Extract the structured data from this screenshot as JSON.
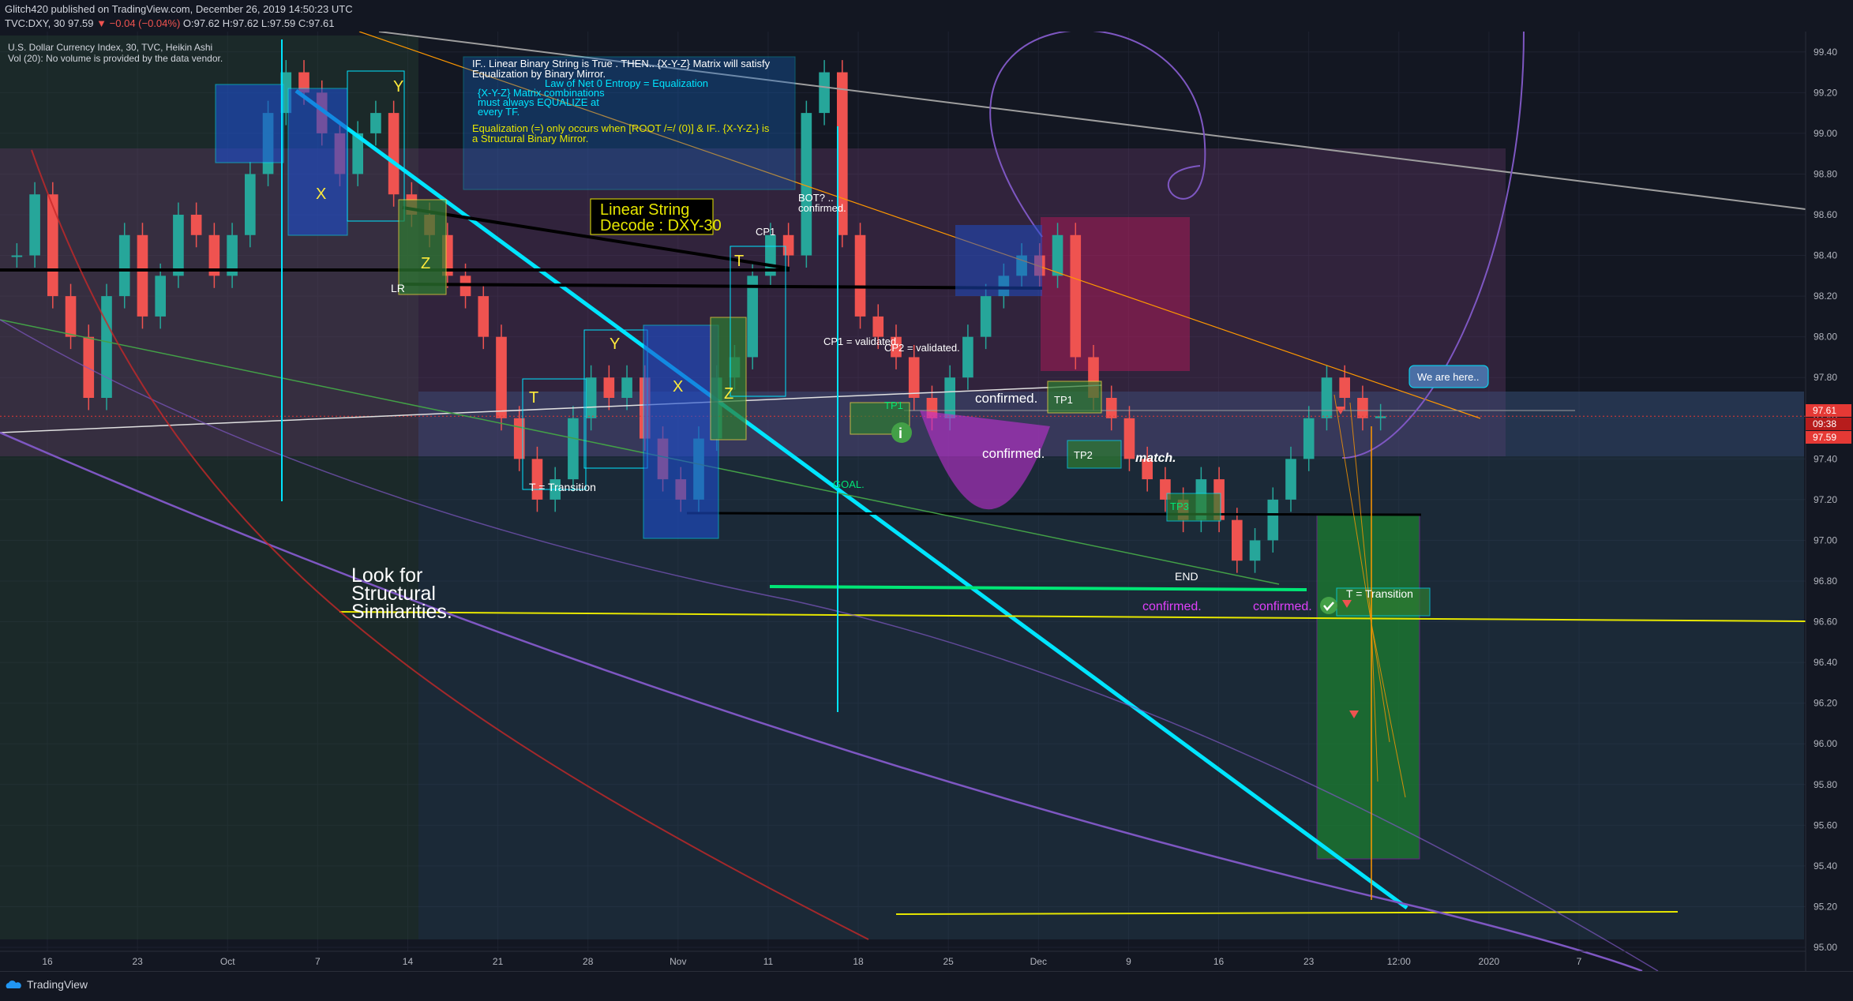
{
  "header": {
    "publisher_line": "Glitch420 published on TradingView.com, December 26, 2019 14:50:23 UTC",
    "symbol": "TVC:DXY, 30",
    "last": "97.59",
    "change": "−0.04 (−0.04%)",
    "ohlc": "O:97.62 H:97.62 L:97.59 C:97.61"
  },
  "legend": {
    "title": "U.S. Dollar Currency Index, 30, TVC, Heikin Ashi",
    "volume_note": "Vol (20): No volume is provided by the data vendor."
  },
  "annotations": {
    "matrix_note": [
      "IF.. Linear Binary String is True . THEN.. {X-Y-Z} Matrix will satisfy",
      "Equalization by Binary Mirror.",
      "Law of Net 0 Entropy = Equalization",
      "{X-Y-Z} Matrix combinations",
      "must always EQUALIZE at",
      "every TF.",
      "Equalization (=) only occurs when [ROOT /=/ (0)]  & IF.. {X-Y-Z-} is",
      "a Structural Binary Mirror."
    ],
    "linear_string": [
      "Linear String",
      "Decode : DXY-30"
    ],
    "look_for": [
      "Look for",
      "Structural",
      "Similarities."
    ],
    "we_are_here": "We are here..",
    "transition_left": "T = Transition",
    "transition_right": "T = Transition",
    "confirmed_1": "confirmed.",
    "confirmed_2": "confirmed.",
    "confirmed_3": "confirmed.",
    "confirmed_4": "confirmed.",
    "match": "match.",
    "end": "END",
    "goal": "GOAL.",
    "tp1_a": "TP1",
    "tp1_b": "TP1",
    "tp2": "TP2",
    "tp3": "TP3",
    "lr": "LR",
    "bot": "BOT? ..",
    "bot_confirmed": "confirmed.",
    "validated_1": "CP1 = validated.",
    "validated_2": "CP2 = validated.",
    "cp1": "CP1",
    "x1": "X",
    "y1": "Y",
    "z1": "Z",
    "x2": "X",
    "y2": "Y",
    "z2": "Z",
    "t1": "T",
    "t2": "T",
    "info_icon": "i"
  },
  "price_labels": {
    "current": "97.61",
    "countdown": "09:38",
    "close": "97.59"
  },
  "footer": {
    "brand": "TradingView"
  },
  "colors": {
    "background": "#131722",
    "up": "#26a69a",
    "down": "#ef5350",
    "cyan_trendline": "#00e5ff",
    "yellow_line": "#e6e600",
    "magenta": "#e040fb",
    "purple_curve": "#7e57c2"
  },
  "chart_data": {
    "type": "candlestick",
    "title": "U.S. Dollar Currency Index, 30, TVC, Heikin Ashi",
    "xlabel": "",
    "ylabel": "",
    "x_ticks": [
      "16",
      "23",
      "Oct",
      "7",
      "14",
      "21",
      "28",
      "Nov",
      "11",
      "18",
      "25",
      "Dec",
      "9",
      "16",
      "23",
      "12:00",
      "2020",
      "7"
    ],
    "ylim": [
      95.0,
      99.5
    ],
    "y_ticks": [
      95.0,
      95.2,
      95.4,
      95.6,
      95.8,
      96.0,
      96.2,
      96.4,
      96.6,
      96.8,
      97.0,
      97.2,
      97.4,
      97.6,
      97.8,
      98.0,
      98.2,
      98.4,
      98.6,
      98.8,
      99.0,
      99.2,
      99.4
    ],
    "series": [
      {
        "values": [
          98.4,
          98.7,
          98.2,
          98.0,
          97.7,
          98.2,
          98.5,
          98.1,
          98.3,
          98.6,
          98.5,
          98.3,
          98.5,
          98.8,
          99.1,
          99.3,
          99.2,
          99.0,
          98.8,
          99.0,
          99.1,
          98.7,
          98.6,
          98.5,
          98.3,
          98.2,
          98.0,
          97.6,
          97.4,
          97.2,
          97.3,
          97.6,
          97.8,
          97.7,
          97.8,
          97.5,
          97.3,
          97.2,
          97.5,
          97.8,
          97.9,
          98.3,
          98.5,
          98.4,
          99.1,
          99.3,
          98.5,
          98.1,
          98.0,
          97.9,
          97.7,
          97.6,
          97.8,
          98.0,
          98.2,
          98.3,
          98.4,
          98.3,
          98.5,
          97.9,
          97.7,
          97.6,
          97.4,
          97.3,
          97.2,
          97.1,
          97.3,
          97.1,
          96.9,
          97.0,
          97.2,
          97.4,
          97.6,
          97.8,
          97.7,
          97.6,
          97.61
        ]
      }
    ],
    "levels": [
      {
        "value": 98.29
      },
      {
        "value": 98.21
      },
      {
        "value": 97.11
      },
      {
        "value": 96.74
      },
      {
        "value": 96.59
      },
      {
        "value": 95.16
      },
      {
        "value": 97.61
      }
    ]
  }
}
